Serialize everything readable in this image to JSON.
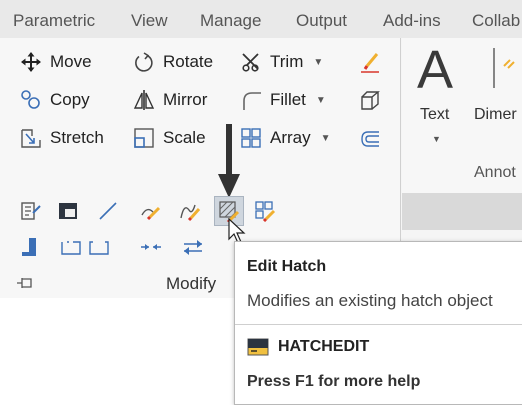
{
  "ribbon_tabs": [
    "Parametric",
    "View",
    "Manage",
    "Output",
    "Add-ins",
    "Collab"
  ],
  "modify": {
    "move": "Move",
    "rotate": "Rotate",
    "trim": "Trim",
    "copy": "Copy",
    "mirror": "Mirror",
    "fillet": "Fillet",
    "stretch": "Stretch",
    "scale": "Scale",
    "array": "Array",
    "panel_title": "Modify",
    "dropdown_glyph": "▼"
  },
  "annotation": {
    "text": "Text",
    "dimension": "Dimer",
    "big_letter": "A",
    "panel_title": "Annot"
  },
  "tooltip": {
    "title": "Edit Hatch",
    "description": "Modifies an existing hatch object",
    "command": "HATCHEDIT",
    "help": "Press F1 for more help"
  },
  "colors": {
    "accent_blue": "#3b6fb6",
    "accent_yellow": "#f0b030",
    "accent_red": "#d9362b"
  }
}
